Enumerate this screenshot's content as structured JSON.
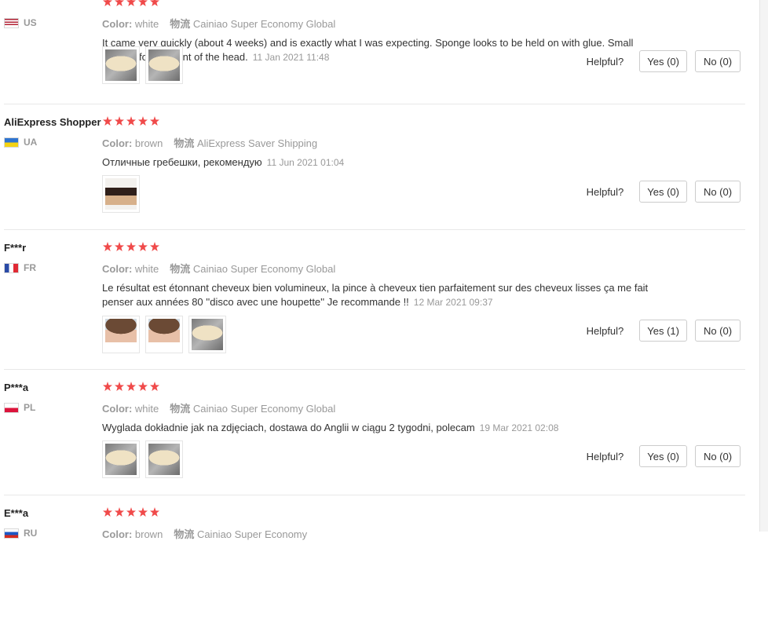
{
  "reviews": [
    {
      "user": "",
      "country": "US",
      "flag": "us",
      "stars": 5,
      "color_label": "Color:",
      "color_value": "white",
      "shipping_label": "物流",
      "shipping_value": "Cainiao Super Economy Global",
      "text": "It came very quickly (about 4 weeks) and is exactly what I was expecting. Sponge looks to be held on with glue. Small enough for the front of the head.",
      "date": "11 Jan 2021 11:48",
      "photos": [
        "comb-white-photo",
        "comb-white-photo"
      ],
      "helpful_label": "Helpful?",
      "yes_label": "Yes (0)",
      "no_label": "No (0)"
    },
    {
      "user": "AliExpress Shopper",
      "country": "UA",
      "flag": "ua",
      "stars": 5,
      "color_label": "Color:",
      "color_value": "brown",
      "shipping_label": "物流",
      "shipping_value": "AliExpress Saver Shipping",
      "text": "Отличные гребешки, рекомендую",
      "date": "11 Jun 2021 01:04",
      "photos": [
        "comb-brown-photo"
      ],
      "helpful_label": "Helpful?",
      "yes_label": "Yes (0)",
      "no_label": "No (0)"
    },
    {
      "user": "F***r",
      "country": "FR",
      "flag": "fr",
      "stars": 5,
      "color_label": "Color:",
      "color_value": "white",
      "shipping_label": "物流",
      "shipping_value": "Cainiao Super Economy Global",
      "text": "Le résultat est étonnant cheveux bien volumineux, la pince à cheveux tien parfaitement sur des cheveux lisses ça me fait penser aux années 80 ''disco avec une houpette'' Je recommande !!",
      "date": "12 Mar 2021 09:37",
      "photos": [
        "hair-photo",
        "hair-photo",
        "comb-white-photo"
      ],
      "helpful_label": "Helpful?",
      "yes_label": "Yes (1)",
      "no_label": "No (0)"
    },
    {
      "user": "P***a",
      "country": "PL",
      "flag": "pl",
      "stars": 5,
      "color_label": "Color:",
      "color_value": "white",
      "shipping_label": "物流",
      "shipping_value": "Cainiao Super Economy Global",
      "text": "Wyglada dokładnie jak na zdjęciach, dostawa do Anglii w ciągu 2 tygodni, polecam",
      "date": "19 Mar 2021 02:08",
      "photos": [
        "comb-white-photo",
        "comb-white-photo"
      ],
      "helpful_label": "Helpful?",
      "yes_label": "Yes (0)",
      "no_label": "No (0)"
    },
    {
      "user": "E***a",
      "country": "RU",
      "flag": "ru",
      "stars": 5,
      "color_label": "Color:",
      "color_value": "brown",
      "shipping_label": "物流",
      "shipping_value": "Cainiao Super Economy",
      "text": "",
      "date": "",
      "photos": [],
      "helpful_label": "",
      "yes_label": "",
      "no_label": ""
    }
  ],
  "colors": {
    "star": "#f04a4a",
    "muted_text": "#999999",
    "body_text": "#333333",
    "border": "#cccccc"
  }
}
